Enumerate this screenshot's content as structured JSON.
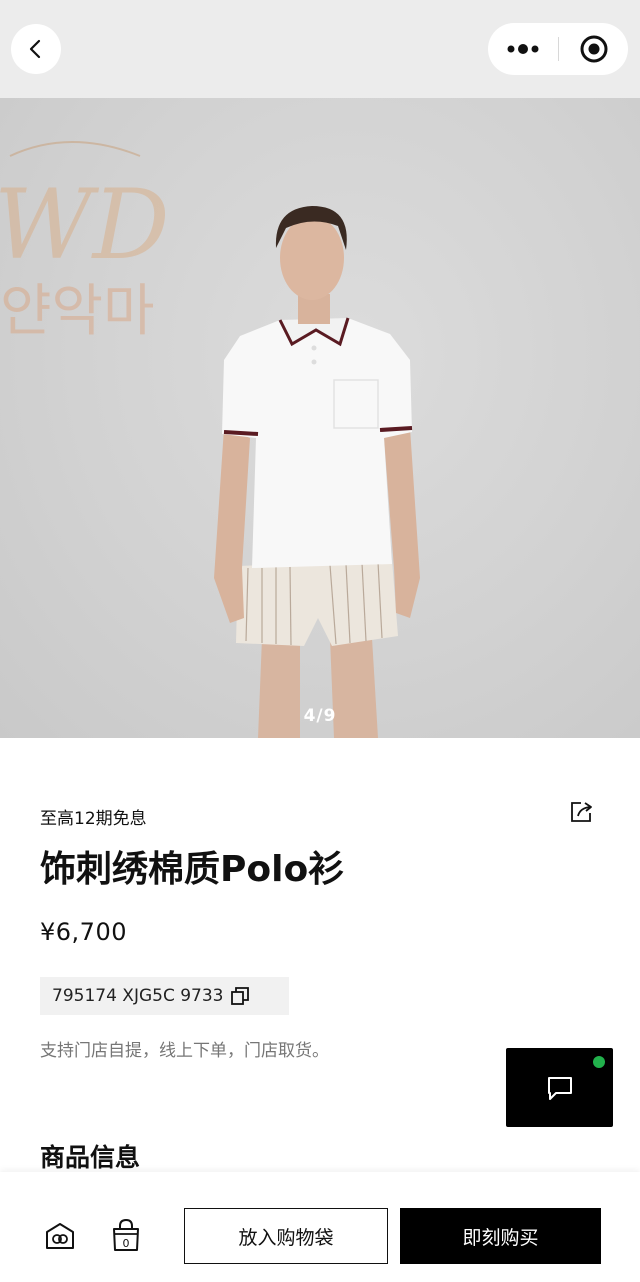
{
  "header": {
    "back_icon": "chevron-left-icon",
    "more_icon": "more-dots-icon",
    "target_icon": "target-circle-icon"
  },
  "hero": {
    "pager": "4/9",
    "watermark_text": "WD",
    "watermark_korean": "얀악마"
  },
  "product": {
    "installment": "至高12期免息",
    "title": "饰刺绣棉质Polo衫",
    "price": "¥6,700",
    "sku": "795174 XJG5C 9733",
    "pickup_note": "支持门店自提，线上下单，门店取货。",
    "share_icon": "share-icon",
    "copy_icon": "copy-icon"
  },
  "chat": {
    "icon": "chat-bubble-icon",
    "status_color": "#22b14c"
  },
  "sections": {
    "info_title": "商品信息"
  },
  "bottom_bar": {
    "store_icon": "store-icon",
    "bag_icon": "shopping-bag-icon",
    "add_to_bag_label": "放入购物袋",
    "buy_now_label": "即刻购买"
  }
}
